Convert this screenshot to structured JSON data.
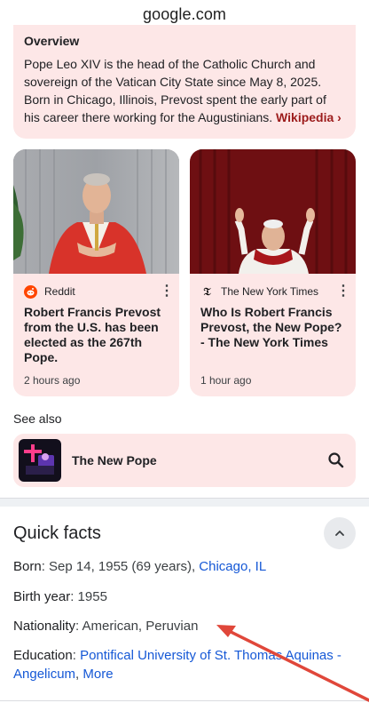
{
  "browser": {
    "url": "google.com"
  },
  "overview": {
    "title": "Overview",
    "text": "Pope Leo XIV is the head of the Catholic Church and sovereign of the Vatican City State since May 8, 2025. Born in Chicago, Illinois, Prevost spent the early part of his career there working for the Augustinians.",
    "source_link": "Wikipedia ›"
  },
  "cards": [
    {
      "source": "Reddit",
      "source_icon": "reddit-icon",
      "title": "Robert Francis Prevost from the U.S. has been elected as the 267th Pope.",
      "time": "2 hours ago"
    },
    {
      "source": "The New York Times",
      "source_icon": "nyt-icon",
      "title": "Who Is Robert Francis Prevost, the New Pope? - The New York Times",
      "time": "1 hour ago"
    }
  ],
  "see_also": {
    "heading": "See also",
    "item_label": "The New Pope"
  },
  "quick_facts": {
    "title": "Quick facts",
    "born_label": "Born",
    "born_value": ": Sep 14, 1955 (69 years), ",
    "born_link": "Chicago, IL",
    "birth_year_label": "Birth year",
    "birth_year_value": ": 1955",
    "nationality_label": "Nationality",
    "nationality_value": ": American, Peruvian",
    "education_label": "Education",
    "education_sep": ": ",
    "education_link": "Pontifical University of St. Thomas Aquinas - Angelicum",
    "education_more": "More"
  },
  "colors": {
    "card_bg": "#fde7e7",
    "link": "#1558d6",
    "wiki_link": "#9c1b1b",
    "annotation_arrow": "#e0473a"
  }
}
